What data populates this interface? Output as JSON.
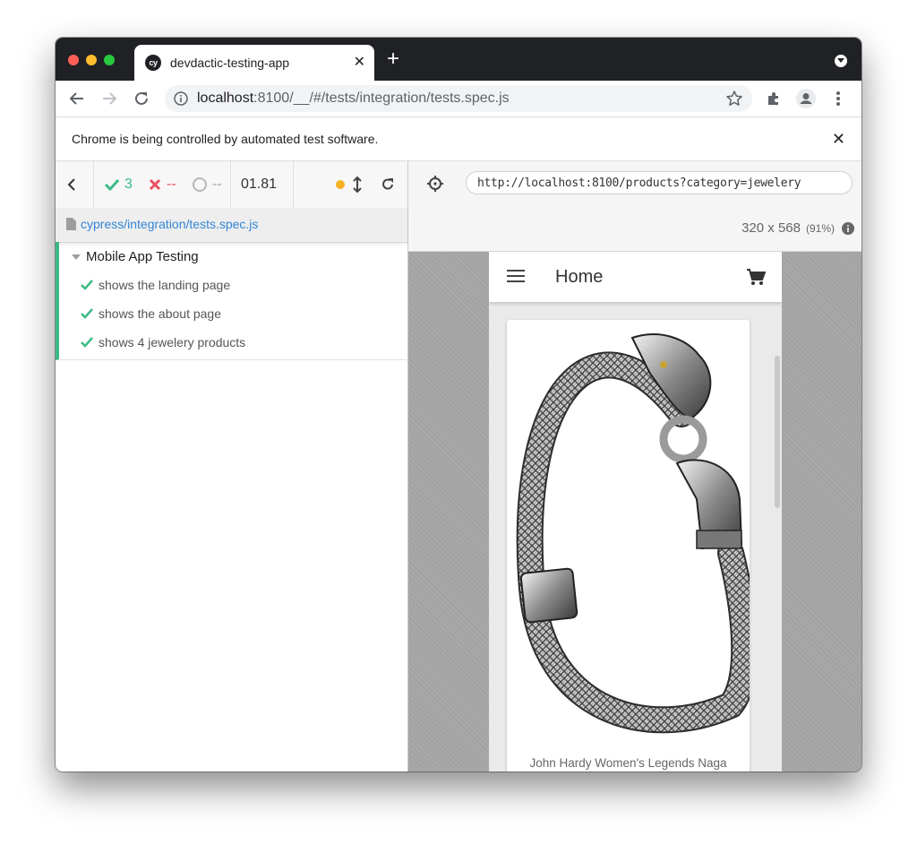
{
  "browser": {
    "tab_title": "devdactic-testing-app",
    "tab_favicon_text": "cy",
    "url_host": "localhost",
    "url_rest": ":8100/__/#/tests/integration/tests.spec.js",
    "infobar_text": "Chrome is being controlled by automated test software."
  },
  "reporter": {
    "passed_count": "3",
    "failed_count": "--",
    "pending_count": "--",
    "duration": "01.81",
    "spec_file": "cypress/integration/tests.spec.js",
    "suite_title": "Mobile App Testing",
    "tests": [
      {
        "title": "shows the landing page",
        "status": "passed"
      },
      {
        "title": "shows the about page",
        "status": "passed"
      },
      {
        "title": "shows 4 jewelery products",
        "status": "passed"
      }
    ]
  },
  "aut": {
    "url": "http://localhost:8100/products?category=jewelery",
    "viewport_size": "320 x 568",
    "viewport_scale": "(91%)",
    "app": {
      "title": "Home",
      "product_name": "John Hardy Women's Legends Naga"
    }
  },
  "colors": {
    "pass": "#3cba85",
    "fail": "#e94f5f",
    "running": "#f5b324",
    "link": "#3385d6",
    "tabstrip": "#202124"
  }
}
